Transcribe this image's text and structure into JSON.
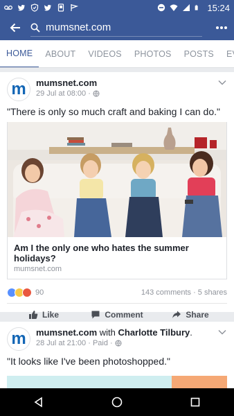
{
  "status_bar": {
    "time": "15:24",
    "icons": [
      "voicemail-icon",
      "twitter-icon",
      "shield-icon",
      "twitter-icon",
      "phone-icon",
      "flag-icon",
      "do-not-disturb-icon",
      "wifi-icon",
      "signal-icon",
      "battery-icon"
    ]
  },
  "app_bar": {
    "search_text": "mumsnet.com",
    "icons": [
      "back-arrow-icon",
      "search-icon",
      "more-icon"
    ]
  },
  "tabs": [
    {
      "label": "HOME",
      "active": true
    },
    {
      "label": "ABOUT",
      "active": false
    },
    {
      "label": "VIDEOS",
      "active": false
    },
    {
      "label": "PHOTOS",
      "active": false
    },
    {
      "label": "POSTS",
      "active": false
    },
    {
      "label": "EVENTS",
      "active": false
    }
  ],
  "posts": [
    {
      "avatar_letter": "m",
      "page": "mumsnet.com",
      "time": "29 Jul at 08:00 ·",
      "text": "\"There is only so much craft and baking I can do.\"",
      "link": {
        "title": "Am I the only one who hates the summer holidays?",
        "domain": "mumsnet.com"
      },
      "reaction_count": "90",
      "comments_shares": "143 comments · 5 shares",
      "actions": [
        "Like",
        "Comment",
        "Share"
      ]
    },
    {
      "avatar_letter": "m",
      "page": "mumsnet.com",
      "with_text": " with ",
      "with_name": "Charlotte Tilbury",
      "with_end": ".",
      "time": "28 Jul at 21:00 · Paid ·",
      "text": "\"It looks like I've been photoshopped.\""
    }
  ],
  "colors": {
    "brand": "#3b5998",
    "avatar_m": "#1366b5",
    "like_blue": "#5890ff",
    "haha_yellow": "#f7c94a",
    "angry_red": "#e9573f"
  }
}
